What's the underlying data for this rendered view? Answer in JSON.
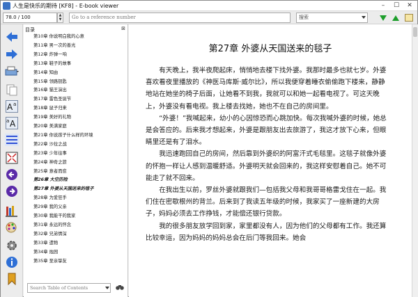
{
  "window": {
    "title": "人生是快乐的期待 [KF8] - E-book viewer",
    "minimize": "–",
    "maximize": "☐",
    "close": "✕"
  },
  "toolbar": {
    "position_value": "78.0 / 100",
    "reference_placeholder": "Go to a reference number",
    "search_placeholder": "搜索"
  },
  "toc": {
    "header": "目录",
    "close": "⊠",
    "search_placeholder": "Search Table of Contents",
    "search_icon": "binoculars-icon",
    "items": [
      {
        "label": "第10章 你说明白我的心意",
        "selected": false
      },
      {
        "label": "第11章 男一次的善光",
        "selected": false
      },
      {
        "label": "第12章 炸弹一响",
        "selected": false
      },
      {
        "label": "第13章 鞋子的故事",
        "selected": false
      },
      {
        "label": "第14章 知由",
        "selected": false
      },
      {
        "label": "第15章 领路钥匙",
        "selected": false
      },
      {
        "label": "第16章 猫王演出",
        "selected": false
      },
      {
        "label": "第17章 雷色圣诞节",
        "selected": false
      },
      {
        "label": "第18章 鼠子归来",
        "selected": false
      },
      {
        "label": "第19章 美好的礼物",
        "selected": false
      },
      {
        "label": "第20章 美满家庭",
        "selected": false
      },
      {
        "label": "第21章 你说孩子什么样的环境",
        "selected": false
      },
      {
        "label": "第22章 沙拉之战",
        "selected": false
      },
      {
        "label": "第23章 少年往事",
        "selected": false
      },
      {
        "label": "第24章 神奇之旅",
        "selected": false
      },
      {
        "label": "第25章 意者而愈",
        "selected": false
      },
      {
        "label": "第26章 大空历险",
        "selected": true
      },
      {
        "label": "第27章 外婆从天国送来的毯子",
        "selected": true
      },
      {
        "label": "第28章 为爱狂手",
        "selected": false
      },
      {
        "label": "第29章 我的父亲",
        "selected": false
      },
      {
        "label": "第30章 我能干的我家",
        "selected": false
      },
      {
        "label": "第31章 永远的怀念",
        "selected": false
      },
      {
        "label": "第32章 兄弟情深",
        "selected": false
      },
      {
        "label": "第33章 遗物",
        "selected": false
      },
      {
        "label": "第34章 烛园",
        "selected": false
      },
      {
        "label": "第35章 至亲挚友",
        "selected": false
      }
    ]
  },
  "content": {
    "chapter_title": "第27章 外婆从天国送来的毯子",
    "paragraphs": [
      "有天晚上，我半夜爬起床，悄悄地去楼下找外婆。我那时最多也就七岁。外婆喜欢看夜里播放的《神医马库斯·威尔比》，所以我便穿着睡衣偷偷跑下楼来，静静地站在她坐的椅子后面，让她看不到我，我就可以和她一起看电视了。可这天晚上，外婆没有看电视。我上楼去找她，她也不在自己的房间里。",
      "“外婆！”我喊起来，幼小的心因惊恐而心跳加快。每次我喊外婆的时候，她总是会答应的。后来我才想起来，外婆是跟朋友出去旅游了，我这才放下心来，但眼睛里还是有了泪水。",
      "我迅速跑回自己的房间，然后靠到外婆织的阿富汗式毛毯里。这毯子就像外婆的怀抱一样让人感到温暖舒适。外婆明天就会回来的，我这样安慰着自己。她不可能走了就不回来。",
      "在我出生以前，罗丝外婆就跟我们—包括我父母和我哥哥格雷戈住在一起。我们住在密歇根州的背兰。后来到了我读五年级的时候，我家买了一座新建的大房子，妈妈必须去工作挣钱，才能偿还银行贷款。",
      "我的很多朋友放学回到家，家里都没有人，因为他们的父母都有工作。我还算比较幸运，因为妈妈的妈妈总会在后门等我回来。她会"
    ]
  },
  "sidebar": {
    "buttons": [
      {
        "name": "back-icon"
      },
      {
        "name": "forward-icon"
      },
      {
        "name": "print-icon"
      },
      {
        "name": "copy-icon"
      },
      {
        "name": "font-larger-icon"
      },
      {
        "name": "font-smaller-icon"
      },
      {
        "name": "toc-icon"
      },
      {
        "name": "fullscreen-icon"
      },
      {
        "name": "previous-page-icon"
      },
      {
        "name": "next-page-icon"
      },
      {
        "name": "library-icon"
      },
      {
        "name": "themes-icon"
      },
      {
        "name": "preferences-icon"
      },
      {
        "name": "info-icon"
      },
      {
        "name": "bookmark-icon"
      }
    ]
  },
  "colors": {
    "accent_blue": "#2e6fd6",
    "green_arrow": "#1d9e2b",
    "purple_nav": "#5a2aa8"
  }
}
